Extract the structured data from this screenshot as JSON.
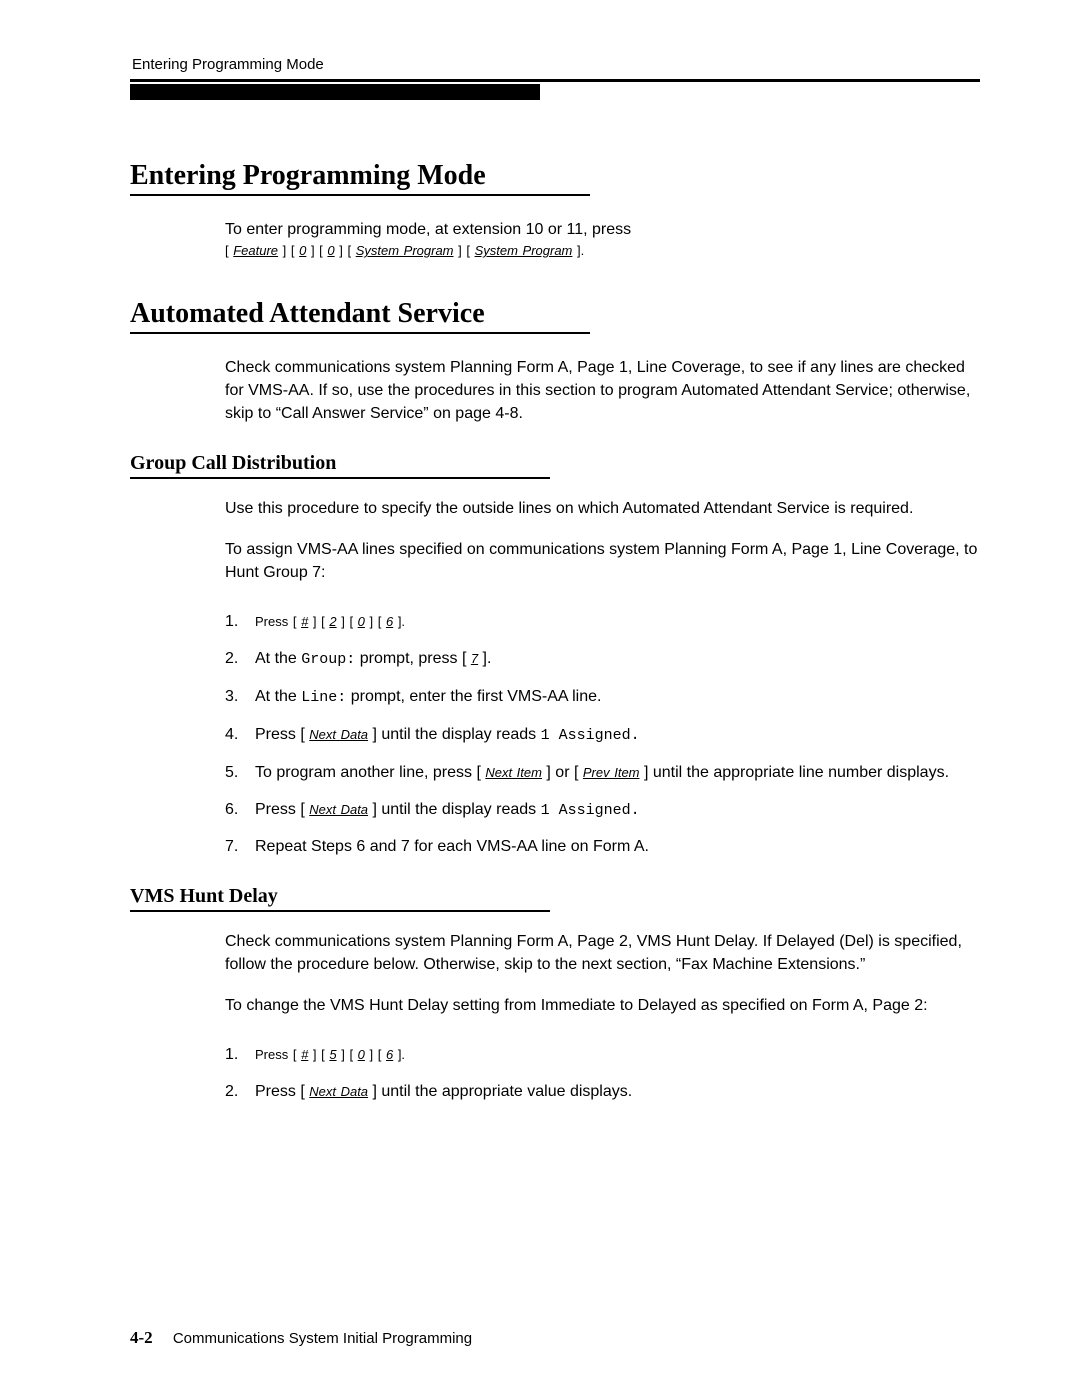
{
  "running_head": "Entering Programming Mode",
  "section1": {
    "title": "Entering Programming Mode",
    "intro": "To enter programming mode, at extension 10 or 11, press",
    "keys": {
      "feature": "Feature",
      "zero1": "0",
      "zero2": "0",
      "sp1": "System Program",
      "sp2": "System Program"
    }
  },
  "section2": {
    "title": "Automated Attendant Service",
    "intro": "Check communications system Planning Form A, Page 1, Line Coverage, to see if any lines are checked for VMS-AA. If so, use the procedures in this section to program Automated Attendant Service; otherwise, skip to “Call Answer Service” on page 4-8."
  },
  "section3": {
    "title": "Group Call Distribution",
    "p1": "Use this procedure to specify the outside lines on which Automated Attendant Service is required.",
    "p2": "To assign VMS-AA lines specified on communications system Planning Form A, Page 1, Line Coverage, to Hunt Group 7:",
    "steps": {
      "s1_pre": "Press [ ",
      "s1_k": [
        "#",
        "2",
        "0",
        "6"
      ],
      "s2_pre": "At the ",
      "s2_code": "Group:",
      "s2_mid": " prompt, press [ ",
      "s2_key": "7",
      "s2_post": " ].",
      "s3_pre": "At the ",
      "s3_code": "Line:",
      "s3_post": " prompt, enter the first VMS-AA line.",
      "s4_pre": "Press [ ",
      "s4_key": "Next Data",
      "s4_mid": " ] until the display reads ",
      "s4_code": "1 Assigned.",
      "s5_pre": "To program another line, press [ ",
      "s5_key1": "Next Item",
      "s5_mid": " ] or [ ",
      "s5_key2": "Prev Item",
      "s5_post": " ] until the appropriate line number displays.",
      "s6_pre": "Press [ ",
      "s6_key": "Next Data",
      "s6_mid": " ] until the display reads ",
      "s6_code": "1 Assigned.",
      "s7": "Repeat Steps 6 and 7 for each VMS-AA line on Form A."
    }
  },
  "section4": {
    "title": "VMS Hunt Delay",
    "p1": "Check communications system Planning Form A, Page 2, VMS Hunt Delay. If Delayed (Del) is specified, follow the procedure below. Otherwise, skip to the next section, “Fax Machine Extensions.”",
    "p2": "To change the VMS Hunt Delay setting from Immediate to Delayed as specified on Form A, Page 2:",
    "steps": {
      "s1_pre": "Press [ ",
      "s1_k": [
        "#",
        "5",
        "0",
        "6"
      ],
      "s2_pre": "Press [ ",
      "s2_key": "Next Data",
      "s2_post": " ] until the appropriate value displays."
    }
  },
  "footer": {
    "page_num": "4-2",
    "title": "Communications System Initial Programming"
  },
  "nums": {
    "n1": "1.",
    "n2": "2.",
    "n3": "3.",
    "n4": "4.",
    "n5": "5.",
    "n6": "6.",
    "n7": "7."
  }
}
